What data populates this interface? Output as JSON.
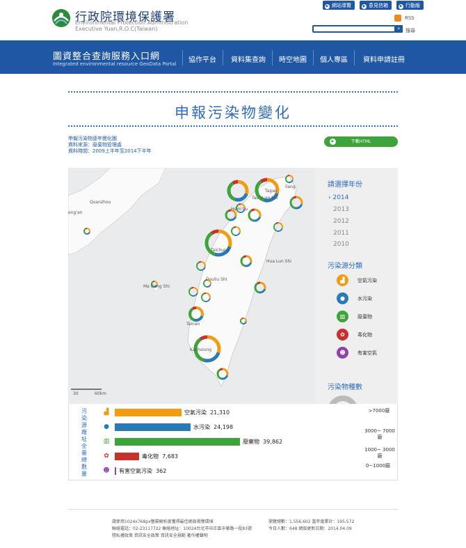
{
  "header": {
    "agency_zh": "行政院環境保護署",
    "agency_en_line1": "Environmental Protection Administration",
    "agency_en_line2": "Executive Yuan,R.O.C(Taiwan)",
    "top_links": [
      "網站導覽",
      "意見信箱",
      "行動版"
    ],
    "rss_label": "RSS",
    "search_label": "搜尋",
    "search_placeholder": ""
  },
  "nav": {
    "portal_title": "圖資整合查詢服務入口網",
    "portal_subtitle": "Integrated environmental resource GeoData Portal",
    "items": [
      "協作平台",
      "資料集查詢",
      "時空地圖",
      "個人專區",
      "資料申請註冊"
    ]
  },
  "page": {
    "title": "申報污染物變化",
    "meta_lines": [
      "申報污染物逐年變化圖",
      "資料來源：廢棄物管理處",
      "資料時間：2009上半年至2014下半年"
    ],
    "download_label": "下載HTML"
  },
  "map": {
    "city_labels": [
      "Quanzhou",
      "Taipei",
      "Tao Yuan Shi",
      "Hsinchu",
      "Taichung",
      "Hua Lun Shi",
      "Douliu Shi",
      "Ma Gong Shi",
      "Tainan",
      "Kaohsiung"
    ],
    "partial_labels": [
      "eng'an",
      "ilang"
    ],
    "scale_labels": [
      "30",
      "60km"
    ]
  },
  "side": {
    "year_heading": "請選擇年份",
    "years": [
      "2014",
      "2013",
      "2012",
      "2011",
      "2010"
    ],
    "selected_year": "2014",
    "category_heading": "污染源分類",
    "categories": [
      {
        "label": "空氣污染",
        "icon": "factory-icon",
        "color": "#f39c12"
      },
      {
        "label": "水污染",
        "icon": "water-drop-icon",
        "color": "#2a7ab8"
      },
      {
        "label": "廢棄物",
        "icon": "trash-bin-icon",
        "color": "#3ea33a"
      },
      {
        "label": "毒化物",
        "icon": "toxic-icon",
        "color": "#c9302c"
      },
      {
        "label": "有害空氣",
        "icon": "gas-mask-icon",
        "color": "#8e44ad"
      }
    ],
    "count_heading": "污染物種數",
    "size_legend": [
      ">7000廠",
      "3000~ 7000廠",
      "1000~ 3000廠",
      "0~1000廠"
    ]
  },
  "stats": {
    "vertical_title": "污染源廠址全臺總數量",
    "rows": [
      {
        "label": "空氣污染",
        "value": 21310,
        "value_text": "21,310",
        "color": "#f39c12",
        "icon": "factory-icon"
      },
      {
        "label": "水污染",
        "value": 24198,
        "value_text": "24,198",
        "color": "#2a7ab8",
        "icon": "water-drop-icon"
      },
      {
        "label": "廢棄物",
        "value": 39862,
        "value_text": "39,862",
        "color": "#3ea33a",
        "icon": "trash-bin-icon"
      },
      {
        "label": "毒化物",
        "value": 7683,
        "value_text": "7,683",
        "color": "#c9302c",
        "icon": "toxic-icon"
      },
      {
        "label": "有害空氣污染",
        "value": 362,
        "value_text": "362",
        "color": "#8e44ad",
        "icon": "gas-mask-icon"
      }
    ]
  },
  "footer": {
    "left": [
      "請使用1024x768px螢幕解析度獲得最佳網頁瀏覽環境",
      "聯絡電話：02-23117722 聯絡地址：10024台北市中正區中華路一段83號",
      "隱私權政策 資訊安全政策 資訊安全規範 著作權聲明"
    ],
    "right": [
      "瀏覽總數：1,556,602 當年度累計：195,572",
      "今日人數：648 網頁更新日期：2014.04.09"
    ]
  },
  "colors": {
    "brand": "#1f57a5",
    "accent": "#2e6bbf",
    "air": "#f39c12",
    "water": "#2a7ab8",
    "waste": "#3ea33a",
    "toxic": "#c9302c",
    "hazard": "#8e44ad"
  }
}
